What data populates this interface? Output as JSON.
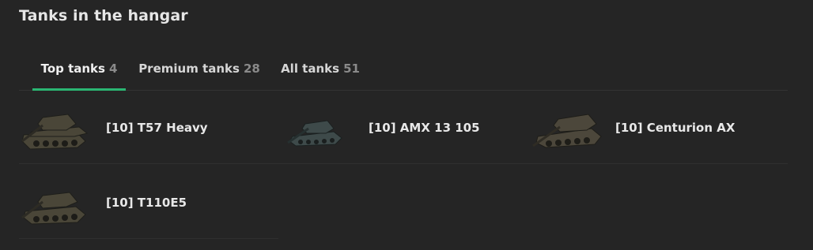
{
  "header": {
    "title": "Tanks in the hangar"
  },
  "tabs": [
    {
      "label": "Top tanks",
      "count": "4",
      "active": true
    },
    {
      "label": "Premium tanks",
      "count": "28",
      "active": false
    },
    {
      "label": "All tanks",
      "count": "51",
      "active": false
    }
  ],
  "tanks": [
    {
      "name": "[10] T57 Heavy",
      "icon": "tank-icon",
      "color": "#4a4638"
    },
    {
      "name": "[10] AMX 13 105",
      "icon": "tank-icon",
      "color": "#3e4a4a"
    },
    {
      "name": "[10] Centurion AX",
      "icon": "tank-icon",
      "color": "#4c473b"
    },
    {
      "name": "[10] T110E5",
      "icon": "tank-icon",
      "color": "#4a4638"
    }
  ],
  "colors": {
    "accent": "#2bb673",
    "background": "#252525"
  }
}
